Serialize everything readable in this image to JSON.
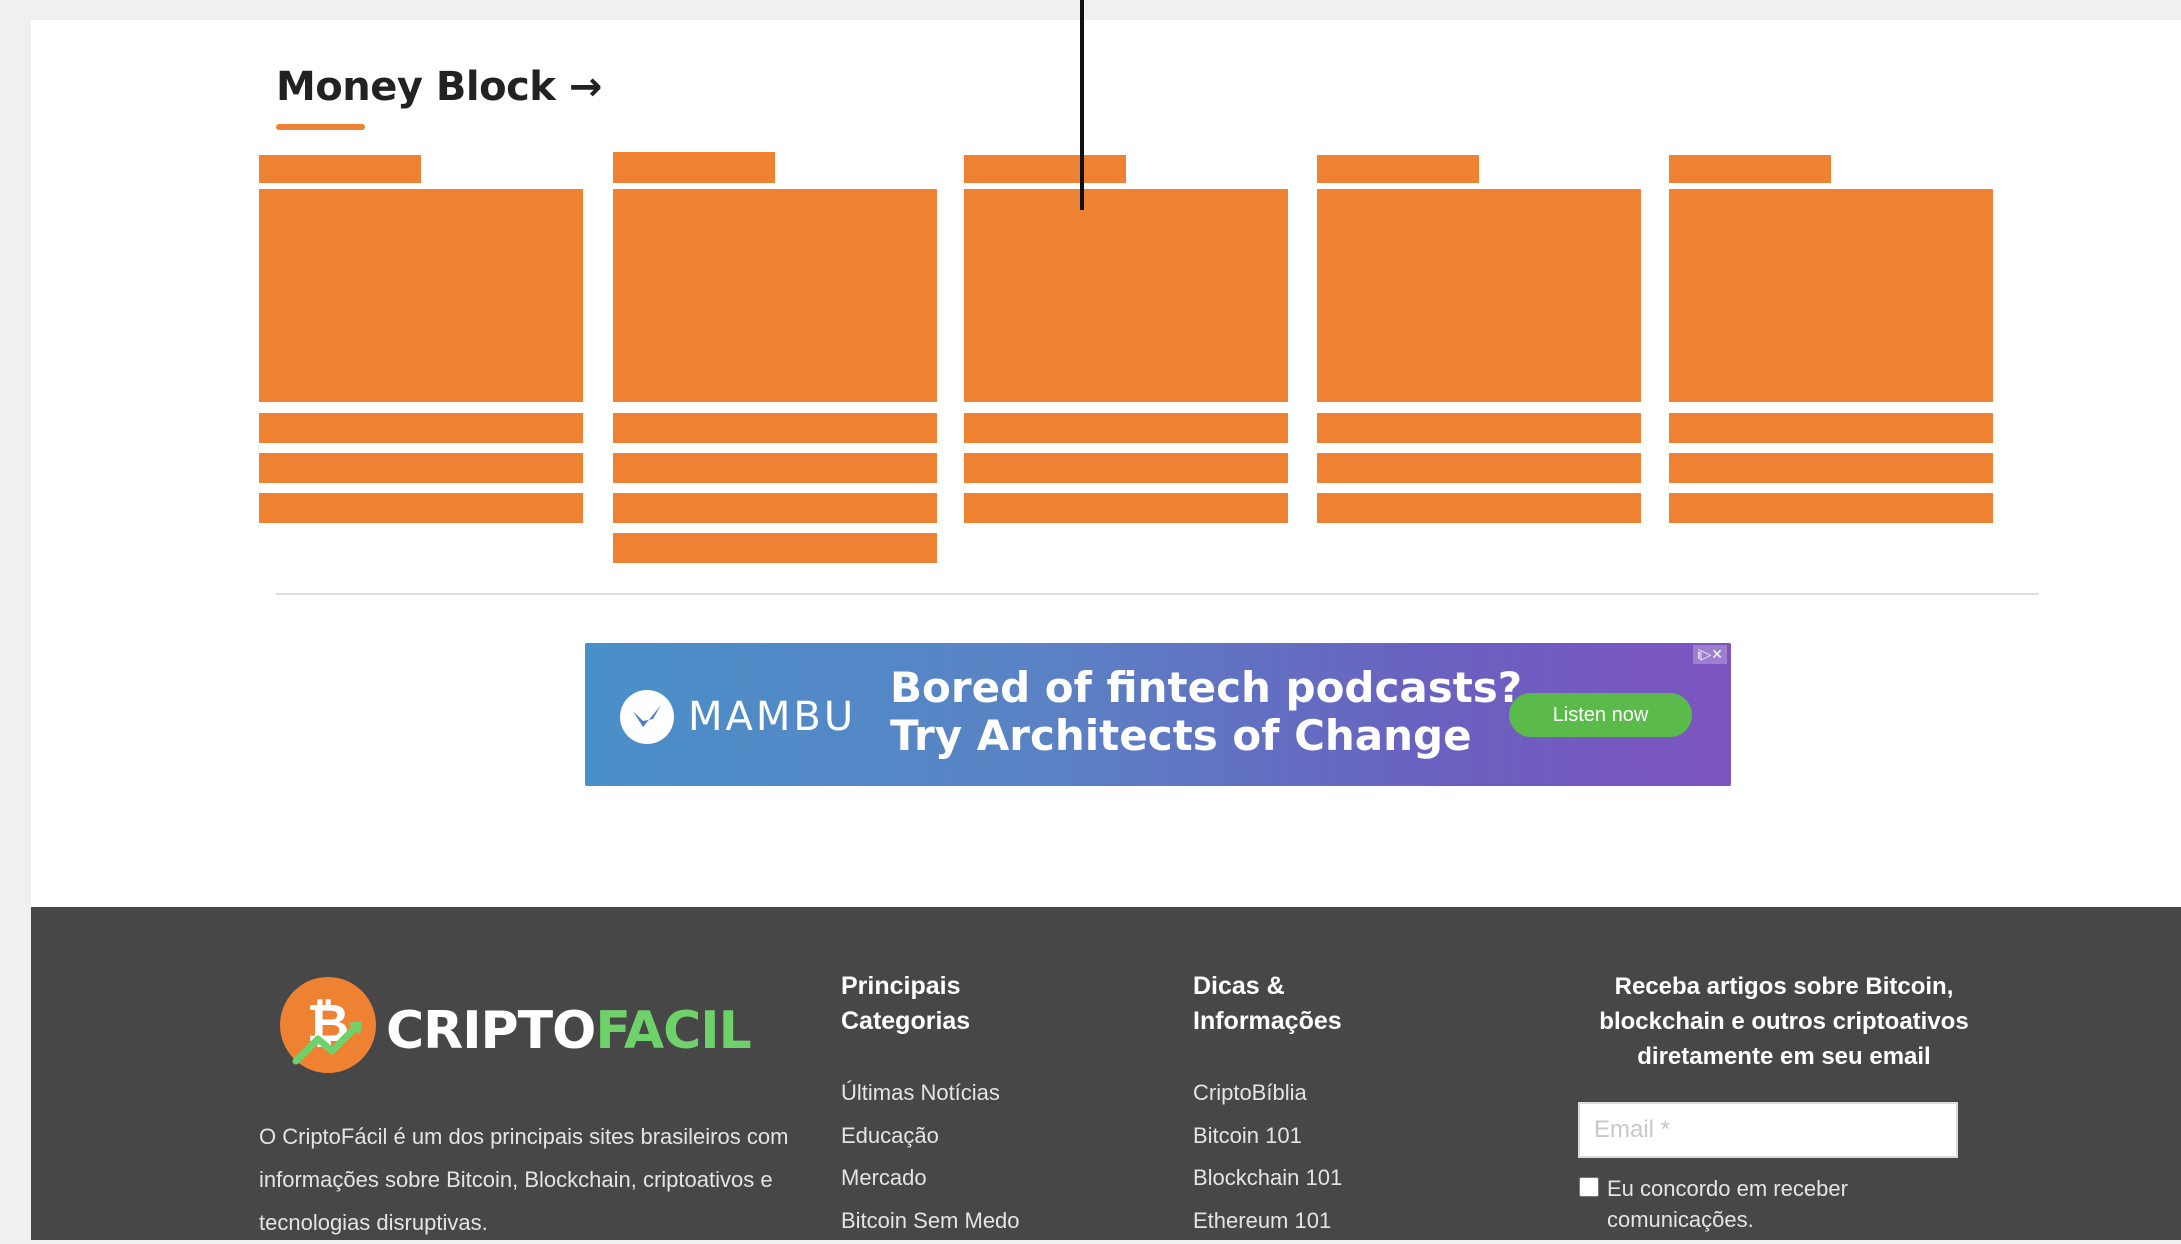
{
  "section": {
    "title": "Money Block",
    "title_arrow": "→",
    "accent_color": "#ef8133"
  },
  "cards": [
    {
      "tag": "",
      "lines": [
        "",
        "",
        ""
      ]
    },
    {
      "tag": "",
      "lines": [
        "",
        "",
        "",
        ""
      ]
    },
    {
      "tag": "",
      "lines": [
        "",
        "",
        ""
      ]
    },
    {
      "tag": "",
      "lines": [
        "",
        "",
        ""
      ]
    },
    {
      "tag": "",
      "lines": [
        "",
        "",
        ""
      ]
    }
  ],
  "ad": {
    "brand": "MAMBU",
    "headline_1": "Bored of fintech podcasts?",
    "headline_2": "Try Architects of Change",
    "cta": "Listen now",
    "badge": "i▷✕",
    "cta_color": "#5bbb4a"
  },
  "footer": {
    "logo_part1": "CRIPTO",
    "logo_part2": "FACIL",
    "about": "O CriptoFácil é um dos principais sites brasileiros com informações sobre Bitcoin, Blockchain, criptoativos e tecnologias disruptivas.",
    "col1_title": "Principais Categorias",
    "col1_items": [
      "Últimas Notícias",
      "Educação",
      "Mercado",
      "Bitcoin Sem Medo"
    ],
    "col2_title": "Dicas & Informações",
    "col2_items": [
      "CriptoBíblia",
      "Bitcoin 101",
      "Blockchain 101",
      "Ethereum 101"
    ],
    "newsletter_title": "Receba artigos sobre Bitcoin, blockchain e outros criptoativos diretamente em seu email",
    "email_placeholder": "Email *",
    "consent": "Eu concordo em receber comunicações."
  }
}
